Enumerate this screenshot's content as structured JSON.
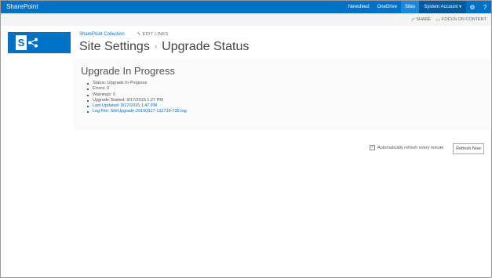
{
  "suitebar": {
    "brand": "SharePoint",
    "links": [
      "Newsfeed",
      "OneDrive",
      "Sites"
    ],
    "active_link": "Sites",
    "user": "System Account ▾",
    "icons": [
      "gear-icon",
      "help-icon"
    ]
  },
  "ribbon": {
    "share": "SHARE",
    "focus": "FOCUS ON CONTENT"
  },
  "site": {
    "collection_link": "SharePoint Collection",
    "edit_links": "EDIT LINKS",
    "title": "Site Settings",
    "separator": "›",
    "page": "Upgrade Status"
  },
  "upgrade": {
    "heading": "Upgrade In Progress",
    "items": [
      "Status: Upgrade In Progress",
      "Errors: 0",
      "Warnings: 0",
      "Upgrade Started: 9/17/2015 1:27 PM",
      "Last Updated: 9/17/2015 1:47 PM",
      "Log File: SiteUpgrade-20150917-132719-735.log"
    ]
  },
  "controls": {
    "auto_refresh_label": "Automatically refresh every minute",
    "auto_refresh_checked": true,
    "refresh_button": "Refresh Now"
  },
  "colors": {
    "suitebar": "#0072c6",
    "accent": "#0072c6"
  }
}
